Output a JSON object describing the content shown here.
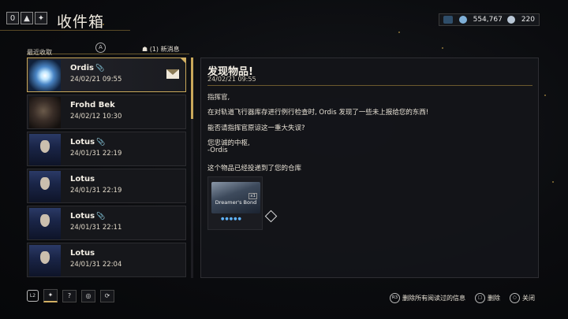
{
  "header": {
    "title": "收件箱",
    "top_icons": [
      "0",
      "▲",
      "✦"
    ]
  },
  "currency": {
    "credits": "554,767",
    "platinum": "220"
  },
  "list": {
    "sort_label": "最近收取",
    "new_messages": "(1) 新消息",
    "items": [
      {
        "sender": "Ordis",
        "date": "24/02/21 09:55",
        "attachment": true,
        "avatar": "ordis",
        "selected": true,
        "unread": true
      },
      {
        "sender": "Frohd Bek",
        "date": "24/02/12 10:30",
        "attachment": false,
        "avatar": "frohd"
      },
      {
        "sender": "Lotus",
        "date": "24/01/31 22:19",
        "attachment": true,
        "avatar": "lotus"
      },
      {
        "sender": "Lotus",
        "date": "24/01/31 22:19",
        "attachment": false,
        "avatar": "lotus"
      },
      {
        "sender": "Lotus",
        "date": "24/01/31 22:11",
        "attachment": true,
        "avatar": "lotus"
      },
      {
        "sender": "Lotus",
        "date": "24/01/31 22:04",
        "attachment": false,
        "avatar": "lotus"
      }
    ]
  },
  "detail": {
    "title": "发现物品!",
    "date": "24/02/21 09:55",
    "lines": [
      "指挥官,",
      "在对轨道飞行器库存进行例行检查时, Ordis 发现了一些未上报给您的东西!",
      "能否请指挥官原谅这一重大失误?",
      "您忠诚的中枢,",
      "-Ordis",
      "这个物品已经投递到了您的仓库"
    ],
    "item": {
      "name": "Dreamer's Bond",
      "tag": "x1",
      "dots": "●●●●●"
    }
  },
  "footer": {
    "l2": "L2",
    "buttons": [
      "✦",
      "?",
      "◎",
      "⟳"
    ],
    "actions": [
      {
        "key": "R3",
        "label": "删除所有阅读过的信息"
      },
      {
        "key": "□",
        "label": "删除"
      },
      {
        "key": "○",
        "label": "关闭"
      }
    ]
  }
}
